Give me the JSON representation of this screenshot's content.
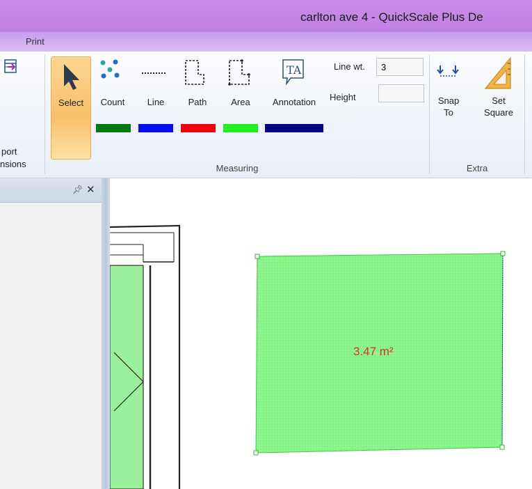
{
  "window": {
    "title": "carlton ave 4 - QuickScale Plus De"
  },
  "menu": {
    "print_label": "Print"
  },
  "ribbon": {
    "import": {
      "label_line1": "port",
      "label_line2": "nsions"
    },
    "measuring": {
      "group_label": "Measuring",
      "tools": [
        {
          "label": "Select",
          "icon": "cursor-arrow-icon"
        },
        {
          "label": "Count",
          "icon": "dots-icon"
        },
        {
          "label": "Line",
          "icon": "dashed-line-icon"
        },
        {
          "label": "Path",
          "icon": "path-icon"
        },
        {
          "label": "Area",
          "icon": "area-icon"
        },
        {
          "label": "Annotation",
          "icon": "text-annotation-icon"
        }
      ],
      "swatch_colors": {
        "count": "#007a10",
        "line": "#0010f0",
        "path": "#f0000a",
        "area": "#22ee22",
        "annotation": "#000080"
      },
      "line_wt_label": "Line wt.",
      "line_wt_value": "3",
      "height_label": "Height",
      "height_value": ""
    },
    "extra": {
      "group_label": "Extra",
      "snap_label_1": "Snap",
      "snap_label_2": "To",
      "square_label_1": "Set",
      "square_label_2": "Square"
    }
  },
  "panel": {
    "pin_icon": "pin-icon",
    "close_icon": "close-icon"
  },
  "canvas": {
    "area_measurement": "3.47 m²",
    "area_fill": "#8cf58c",
    "label_color": "#d4322a"
  }
}
